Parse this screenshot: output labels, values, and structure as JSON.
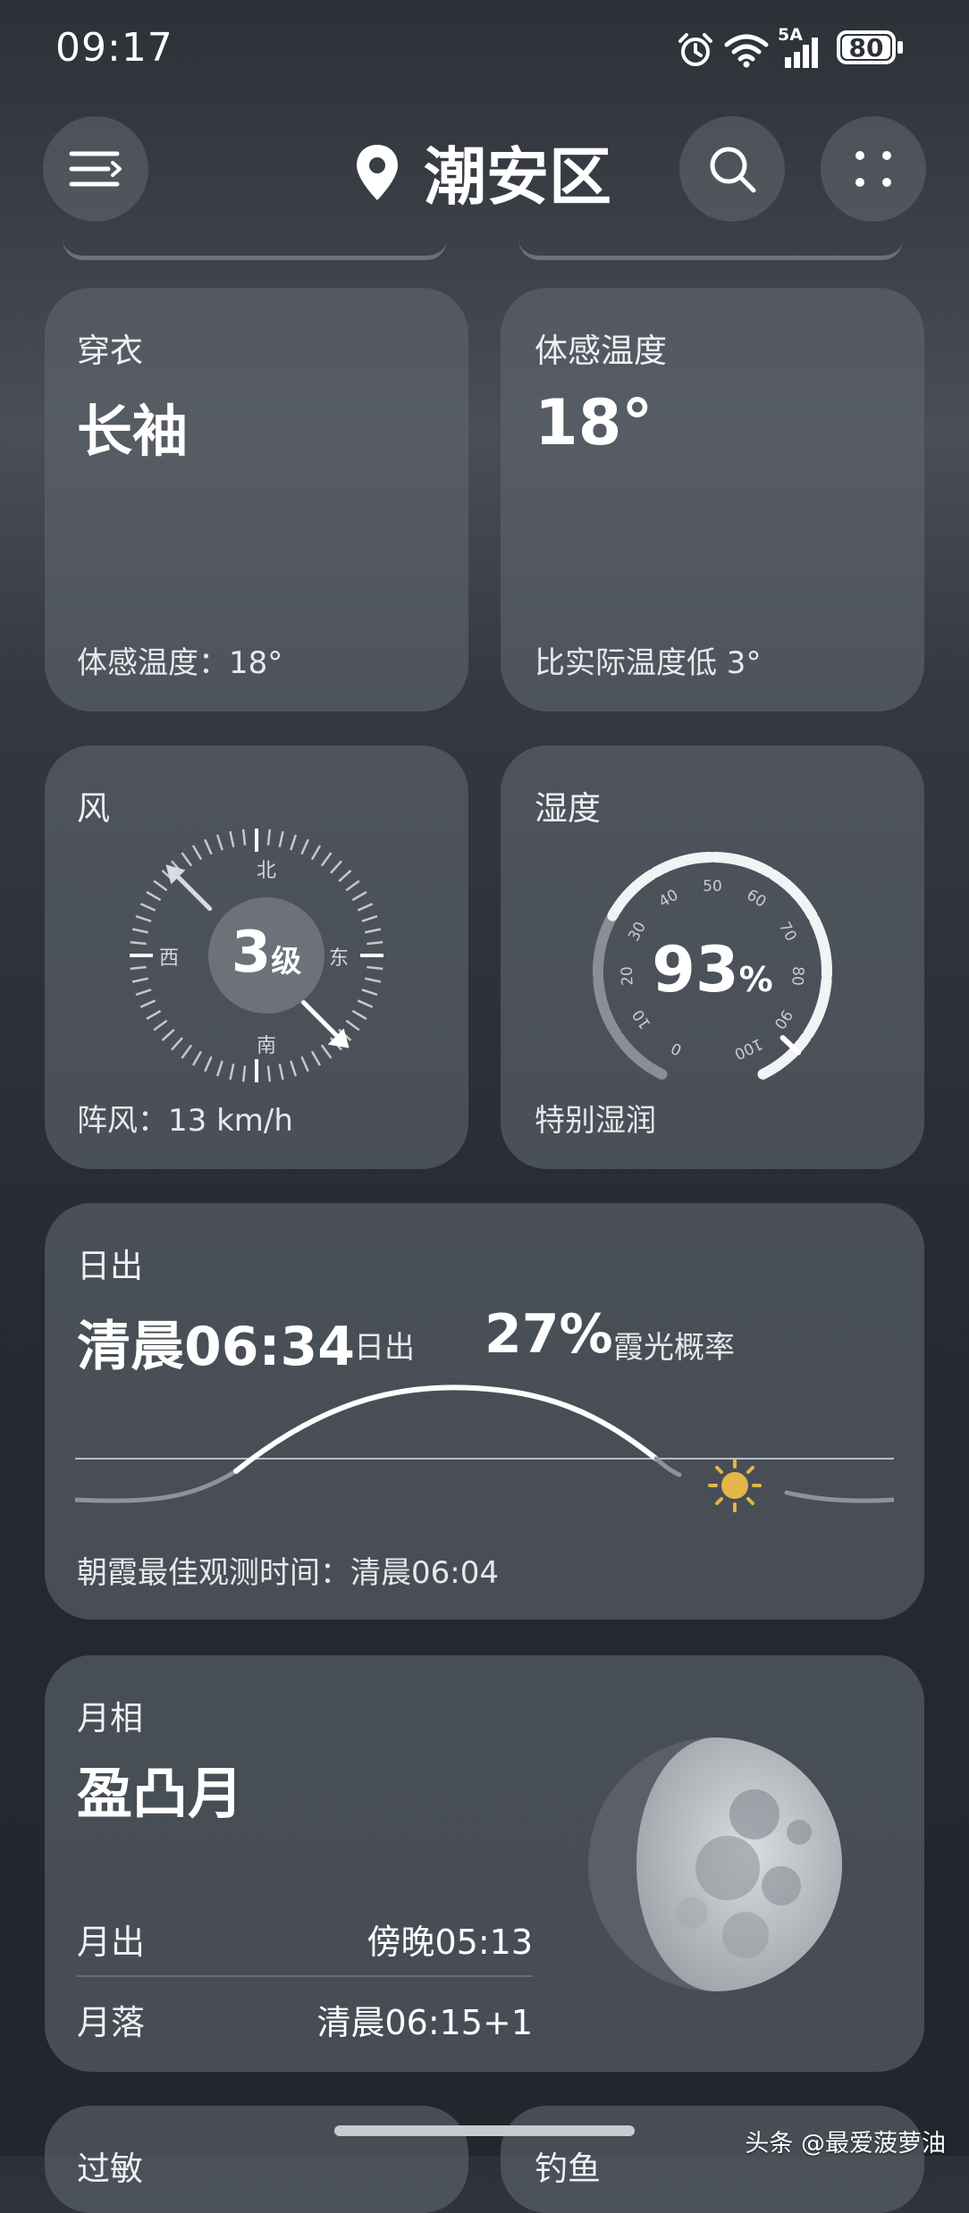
{
  "status_bar": {
    "time": "09:17",
    "network_label": "5A",
    "battery": "80"
  },
  "header": {
    "location": "潮安区"
  },
  "clothing": {
    "title": "穿衣",
    "value": "长袖",
    "footer": "体感温度：18°"
  },
  "feels_like": {
    "title": "体感温度",
    "value": "18°",
    "footer": "比实际温度低 3°"
  },
  "wind": {
    "title": "风",
    "level_number": "3",
    "level_unit": "级",
    "directions": {
      "north": "北",
      "south": "南",
      "east": "东",
      "west": "西"
    },
    "footer": "阵风：13 km/h"
  },
  "humidity": {
    "title": "湿度",
    "number": "93",
    "unit": "%",
    "footer": "特别湿润",
    "value": 93,
    "ticks": [
      "0",
      "10",
      "20",
      "30",
      "40",
      "50",
      "60",
      "70",
      "80",
      "90",
      "100"
    ]
  },
  "sunrise": {
    "title": "日出",
    "time": "清晨06:34",
    "time_suffix": "日出",
    "glow_percent": "27%",
    "glow_label": "霞光概率",
    "footer": "朝霞最佳观测时间：清晨06:04"
  },
  "moon": {
    "title": "月相",
    "phase": "盈凸月",
    "rise_label": "月出",
    "rise_time": "傍晚05:13",
    "set_label": "月落",
    "set_time": "清晨06:15+1"
  },
  "bottom_cards": {
    "left_title": "过敏",
    "right_title": "钓鱼"
  },
  "watermark": "头条 @最爱菠萝油",
  "colors": {
    "card": "#5d626a",
    "sun": "#e3b54a",
    "background": "#262a31"
  }
}
